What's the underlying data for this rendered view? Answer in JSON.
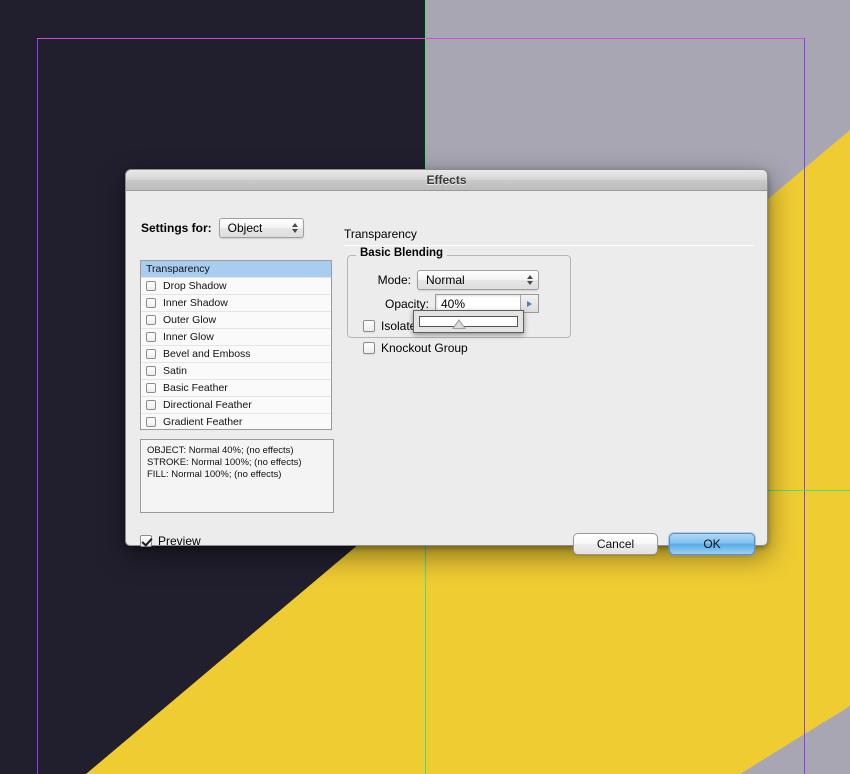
{
  "canvas": {
    "colors": {
      "dark": "#211f2e",
      "gray": "#a8a6b3",
      "yellow": "#f0cc33",
      "guide_magenta": "#d04ddb",
      "guide_purple": "#8a3ff0",
      "guide_green": "#49e07a",
      "page_white": "#ffffff"
    }
  },
  "dialog": {
    "title": "Effects",
    "settings_for": {
      "label": "Settings for:",
      "value": "Object"
    },
    "effects_list": [
      {
        "label": "Transparency",
        "selected": true,
        "has_checkbox": false,
        "checked": false
      },
      {
        "label": "Drop Shadow",
        "selected": false,
        "has_checkbox": true,
        "checked": false
      },
      {
        "label": "Inner Shadow",
        "selected": false,
        "has_checkbox": true,
        "checked": false
      },
      {
        "label": "Outer Glow",
        "selected": false,
        "has_checkbox": true,
        "checked": false
      },
      {
        "label": "Inner Glow",
        "selected": false,
        "has_checkbox": true,
        "checked": false
      },
      {
        "label": "Bevel and Emboss",
        "selected": false,
        "has_checkbox": true,
        "checked": false
      },
      {
        "label": "Satin",
        "selected": false,
        "has_checkbox": true,
        "checked": false
      },
      {
        "label": "Basic Feather",
        "selected": false,
        "has_checkbox": true,
        "checked": false
      },
      {
        "label": "Directional Feather",
        "selected": false,
        "has_checkbox": true,
        "checked": false
      },
      {
        "label": "Gradient Feather",
        "selected": false,
        "has_checkbox": true,
        "checked": false
      }
    ],
    "summary": {
      "line1": "OBJECT: Normal 40%; (no effects)",
      "line2": "STROKE: Normal 100%; (no effects)",
      "line3": "FILL: Normal 100%; (no effects)"
    },
    "panel": {
      "section_title": "Transparency",
      "group_title": "Basic Blending",
      "mode": {
        "label": "Mode:",
        "value": "Normal"
      },
      "opacity": {
        "label": "Opacity:",
        "value": "40%",
        "slider_percent": 40
      },
      "isolate_blending": {
        "label": "Isolate Blending",
        "checked": false
      },
      "knockout_group": {
        "label": "Knockout Group",
        "checked": false
      }
    },
    "footer": {
      "preview": {
        "label": "Preview",
        "checked": true
      },
      "cancel_label": "Cancel",
      "ok_label": "OK"
    }
  }
}
